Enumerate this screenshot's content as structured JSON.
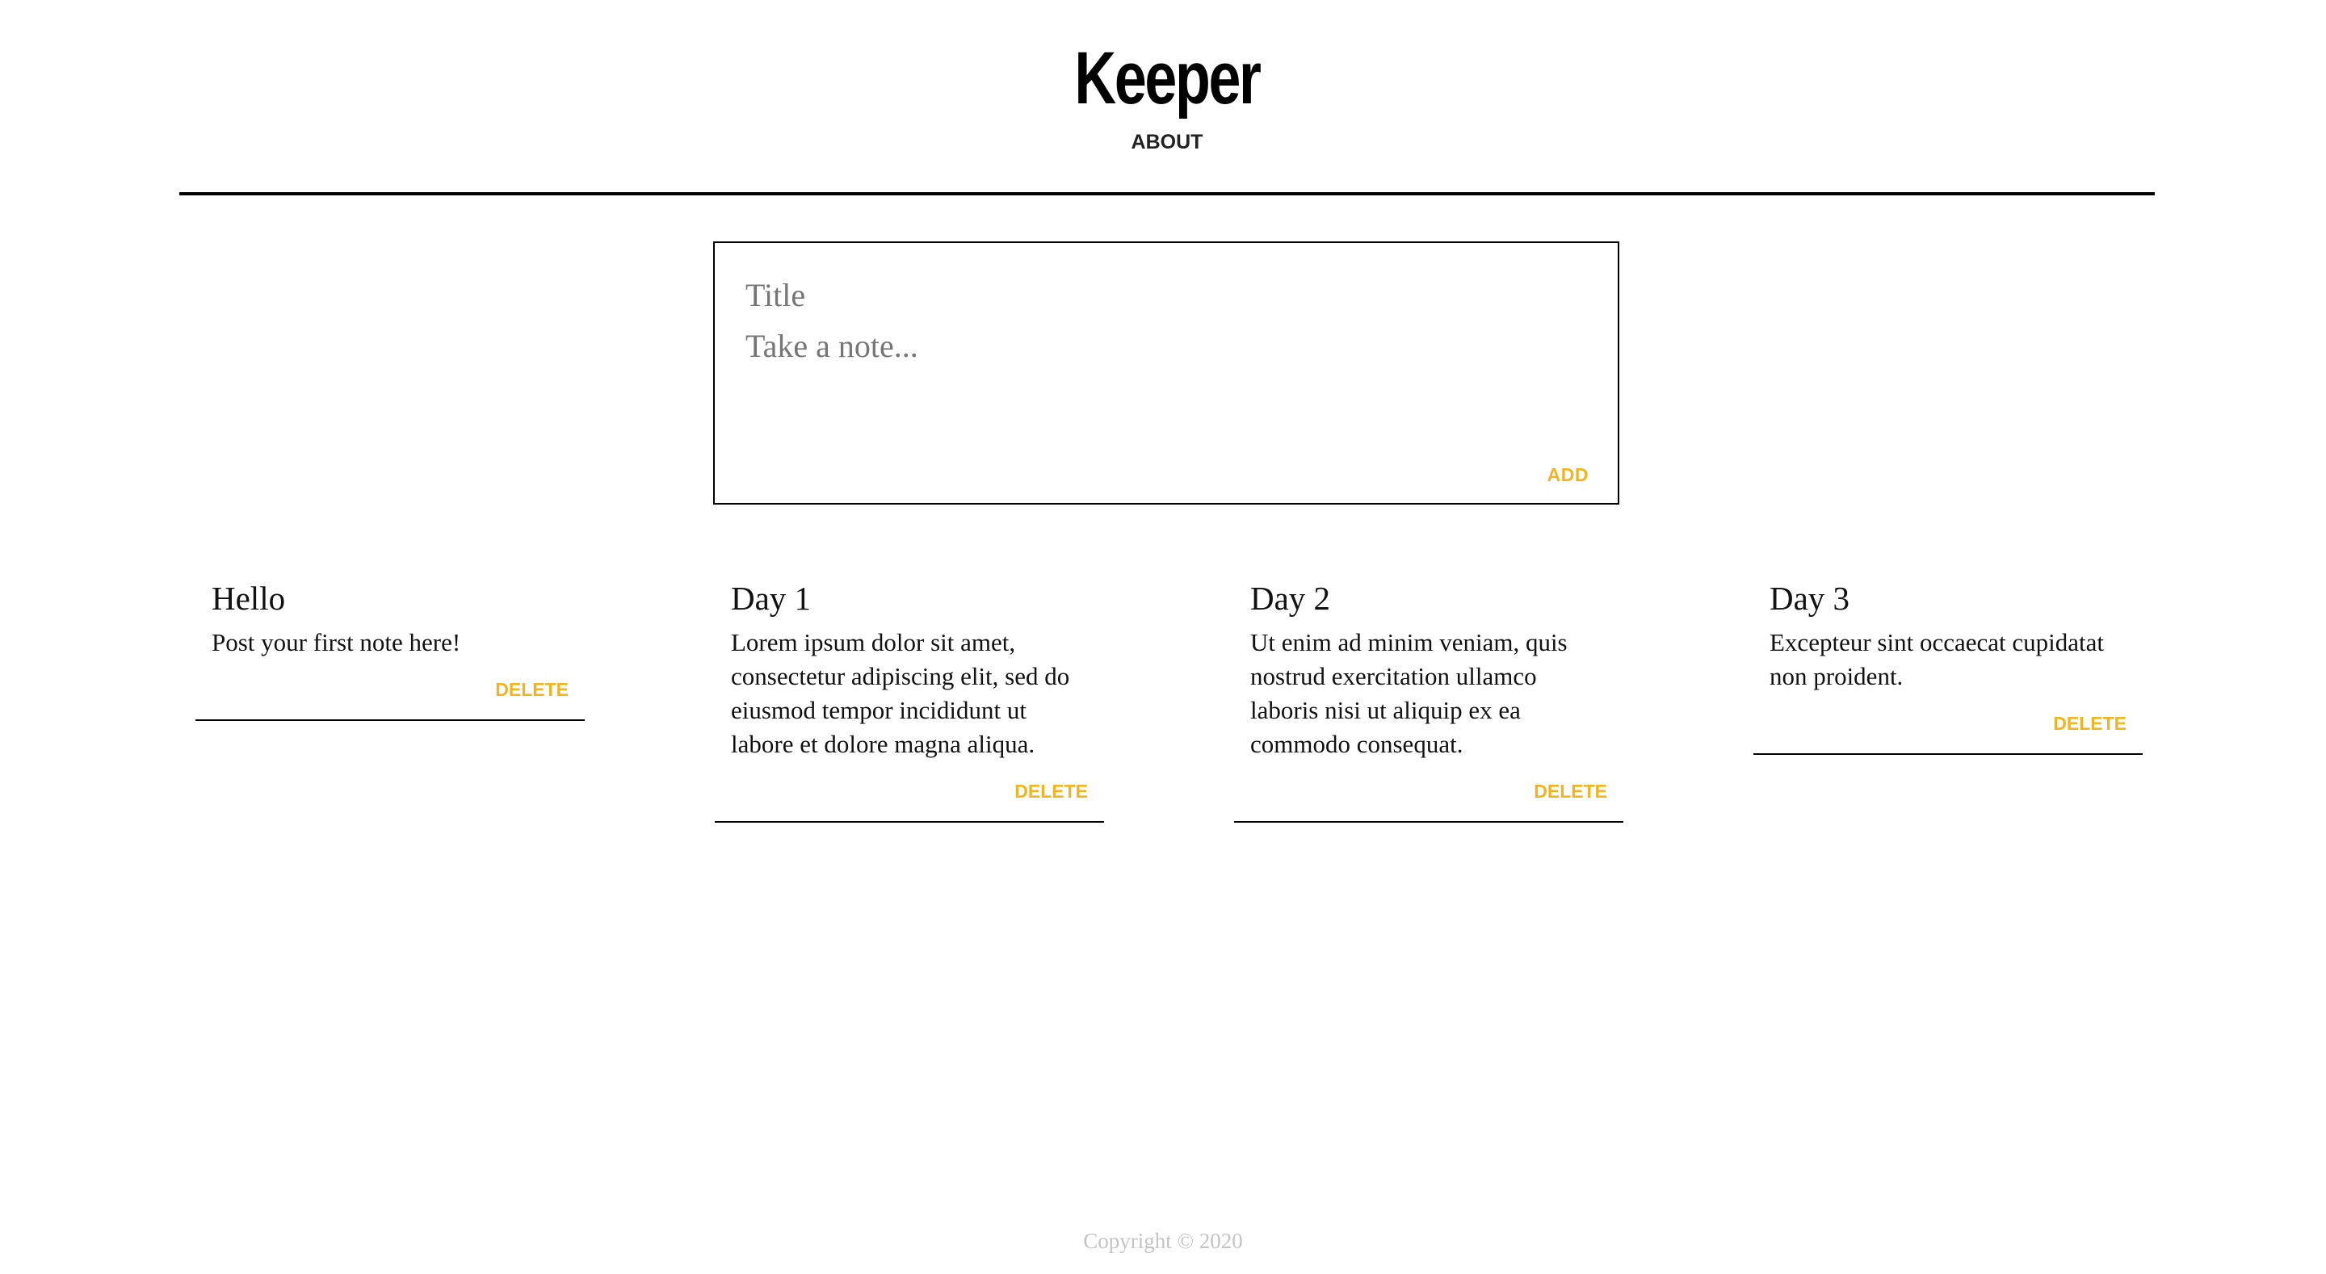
{
  "header": {
    "brand": "Keeper",
    "nav_about": "ABOUT"
  },
  "composer": {
    "title_placeholder": "Title",
    "note_placeholder": "Take a note...",
    "add_label": "ADD"
  },
  "notes": [
    {
      "title": "Hello",
      "body": "Post your first note here!",
      "delete_label": "DELETE"
    },
    {
      "title": "Day 1",
      "body": "Lorem ipsum dolor sit amet, consectetur adipiscing elit, sed do eiusmod tempor incididunt ut labore et dolore magna aliqua.",
      "delete_label": "DELETE"
    },
    {
      "title": "Day 2",
      "body": "Ut enim ad minim veniam, quis nostrud exercitation ullamco laboris nisi ut aliquip ex ea commodo consequat.",
      "delete_label": "DELETE"
    },
    {
      "title": "Day 3",
      "body": "Excepteur sint occaecat cupidatat non proident.",
      "delete_label": "DELETE"
    }
  ],
  "footer": {
    "copyright": "Copyright © 2020"
  },
  "colors": {
    "accent": "#f1b521",
    "rule": "#000000",
    "footer_text": "#c4c4c4"
  }
}
